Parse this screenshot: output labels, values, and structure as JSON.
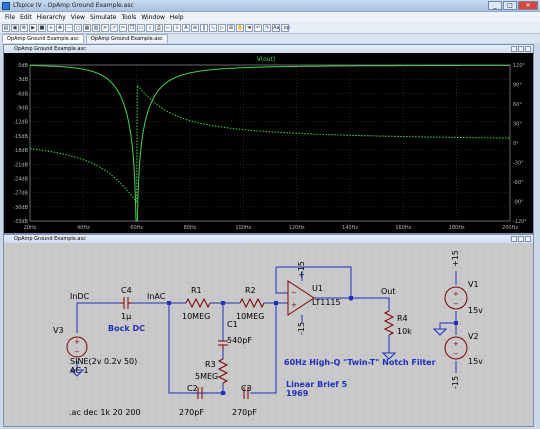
{
  "window": {
    "title": "LTspice IV - OpAmp Ground Example.asc",
    "min": "_",
    "max": "□",
    "close": "✕"
  },
  "menu": [
    "File",
    "Edit",
    "Hierarchy",
    "View",
    "Simulate",
    "Tools",
    "Window",
    "Help"
  ],
  "tabs": [
    {
      "label": "OpAmp Ground Example.asc"
    },
    {
      "label": "OpAmp Ground Example.asc"
    }
  ],
  "waveform": {
    "pane_title": "OpAmp Ground Example.asc",
    "trace_label": "V(out)",
    "colors": {
      "background": "#000000",
      "grid": "#5a5a5a",
      "trace": "#3fd64f",
      "axis_text": "#b0b0b0"
    },
    "chart_data": {
      "type": "line",
      "title": "",
      "series": [
        {
          "name": "V(out)",
          "kind": "magnitude_and_phase"
        }
      ],
      "y_left_ticks": [
        "0dB",
        "-3dB",
        "-6dB",
        "-9dB",
        "-12dB",
        "-15dB",
        "-18dB",
        "-21dB",
        "-24dB",
        "-27dB",
        "-30dB",
        "-33dB"
      ],
      "y_right_ticks": [
        "120°",
        "90°",
        "60°",
        "30°",
        "0°",
        "-30°",
        "-60°",
        "-90°",
        "-120°"
      ],
      "x_ticks": [
        "20Hz",
        "40Hz",
        "60Hz",
        "80Hz",
        "100Hz",
        "120Hz",
        "140Hz",
        "160Hz",
        "180Hz",
        "200Hz"
      ],
      "xlim": [
        20,
        200
      ],
      "ylim": [
        -33,
        0
      ],
      "notch_hz": 60,
      "grid": true
    }
  },
  "schematic": {
    "pane_title": "OpAmp Ground Example.asc",
    "colors": {
      "background": "#c9c9c9",
      "wire": "#1e2fbf",
      "component": "#7a0000",
      "text": "#000000",
      "note": "#1e2fbf",
      "node": "#1e2fbf"
    },
    "nets": {
      "indc": "InDC",
      "inac": "InAC",
      "out": "Out"
    },
    "components": {
      "c4": {
        "ref": "C4",
        "val": "1µ"
      },
      "r1": {
        "ref": "R1",
        "val": "10MEG"
      },
      "r2": {
        "ref": "R2",
        "val": "10MEG"
      },
      "c1": {
        "ref": "C1",
        "val": "540pF"
      },
      "r3": {
        "ref": "R3",
        "val": "5MEG"
      },
      "c2": {
        "ref": "C2",
        "val": "270pF"
      },
      "c3": {
        "ref": "C3",
        "val": "270pF"
      },
      "r4": {
        "ref": "R4",
        "val": "10k"
      },
      "u1": {
        "ref": "U1",
        "val": "LT1115",
        "pos": "+15",
        "neg": "-15"
      },
      "v3": {
        "ref": "V3",
        "val": "SINE(2v 0.2v 50)",
        "ac": "AC 1"
      },
      "v1": {
        "ref": "V1",
        "val": "15v",
        "node": "+15"
      },
      "v2": {
        "ref": "V2",
        "val": "15v",
        "node": "-15"
      }
    },
    "notes": {
      "bock": "Bock DC",
      "title": "60Hz High-Q \"Twin-T\" Notch Filter",
      "brief": "Linear Brief 5",
      "year": "1969",
      "sim": ".ac dec 1k 20 200"
    }
  }
}
